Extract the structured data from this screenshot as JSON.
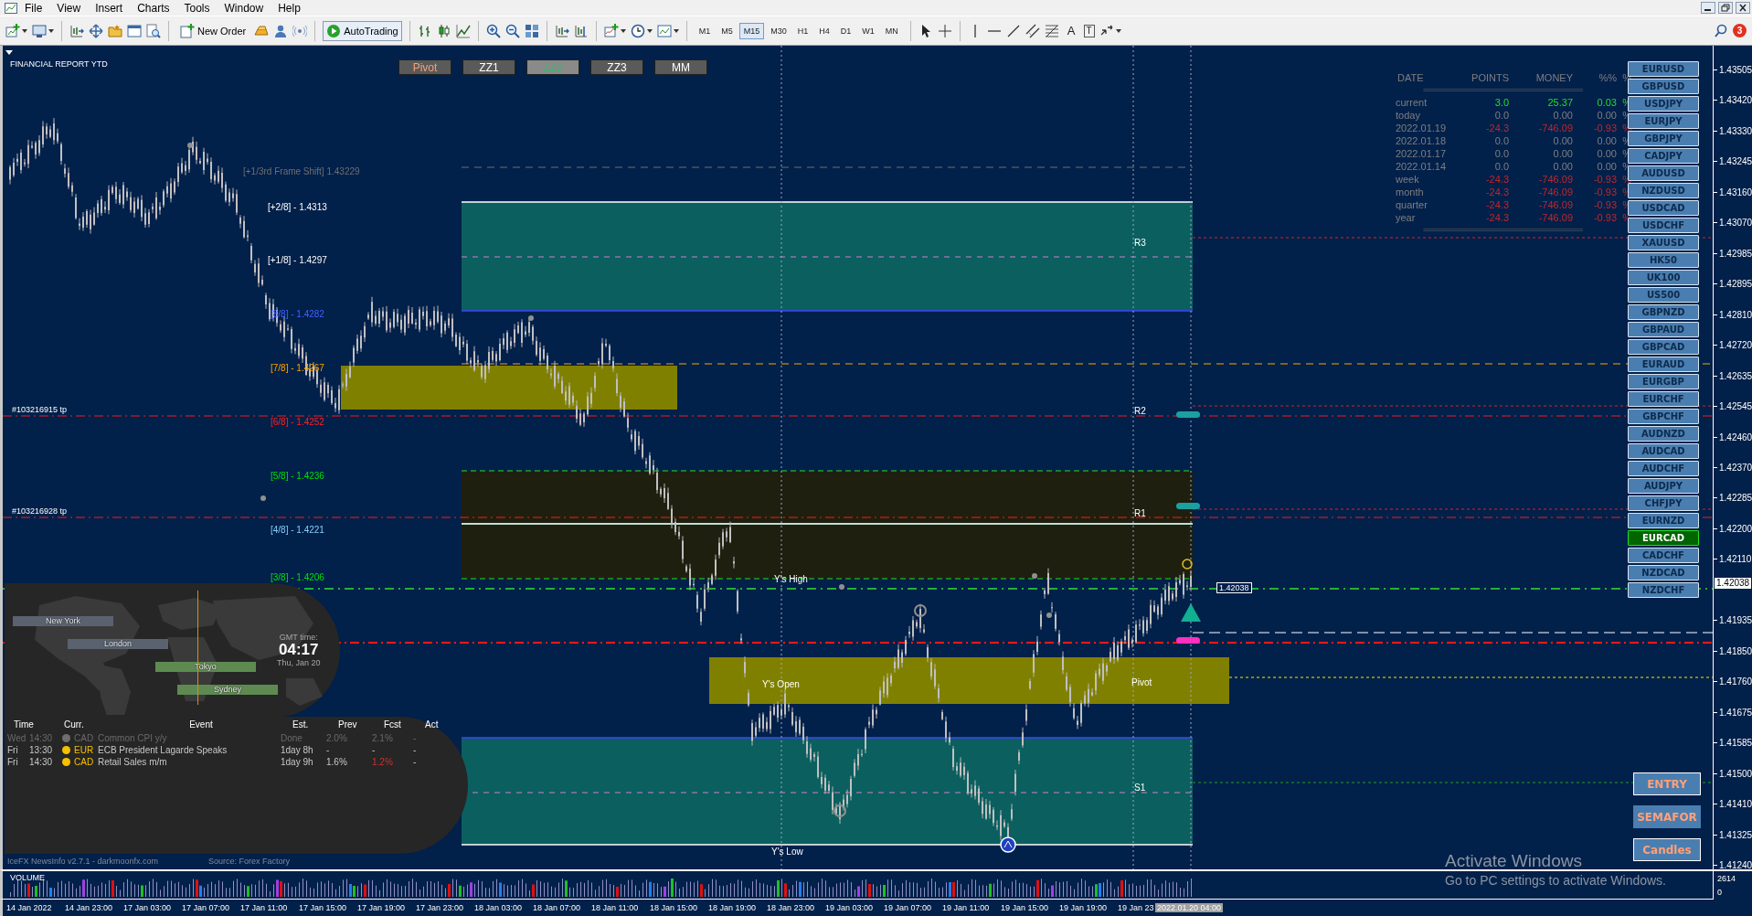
{
  "menu": [
    {
      "label": "File"
    },
    {
      "label": "View"
    },
    {
      "label": "Insert"
    },
    {
      "label": "Charts"
    },
    {
      "label": "Tools"
    },
    {
      "label": "Window"
    },
    {
      "label": "Help"
    }
  ],
  "toolbar": {
    "new_order": "New Order",
    "autotrading": "AutoTrading",
    "timeframes": [
      {
        "label": "M1",
        "selected": false
      },
      {
        "label": "M5",
        "selected": false
      },
      {
        "label": "M15",
        "selected": true
      },
      {
        "label": "M30",
        "selected": false
      },
      {
        "label": "H1",
        "selected": false
      },
      {
        "label": "H4",
        "selected": false
      },
      {
        "label": "D1",
        "selected": false
      },
      {
        "label": "W1",
        "selected": false
      },
      {
        "label": "MN",
        "selected": false
      }
    ],
    "text_tool": "A",
    "label_tool": "T",
    "notifications": "3"
  },
  "chart": {
    "title": "FINANCIAL REPORT YTD",
    "indicator_buttons": [
      {
        "label": "Pivot",
        "pressed": false,
        "highlighted": true
      },
      {
        "label": "ZZ1",
        "pressed": false,
        "highlighted": false
      },
      {
        "label": "ZZ2",
        "pressed": true,
        "highlighted": false
      },
      {
        "label": "ZZ3",
        "pressed": false,
        "highlighted": false
      },
      {
        "label": "MM",
        "pressed": false,
        "highlighted": false
      }
    ],
    "levels": [
      {
        "text": "[+1/3rd Frame Shift]  1.43229",
        "color": "#6f6f6f"
      },
      {
        "text": "[+2/8] - 1.4313",
        "color": "#ffffff"
      },
      {
        "text": "[+1/8] - 1.4297",
        "color": "#ffffff"
      },
      {
        "text": "[8/8] - 1.4282",
        "color": "#4060ff"
      },
      {
        "text": "[7/8] - 1.4267",
        "color": "#ffa500"
      },
      {
        "text": "[6/8] - 1.4252",
        "color": "#ff2020"
      },
      {
        "text": "[5/8] - 1.4236",
        "color": "#00e000"
      },
      {
        "text": "[4/8] - 1.4221",
        "color": "#87cefa"
      },
      {
        "text": "[3/8] - 1.4206",
        "color": "#00e000"
      }
    ],
    "trade_labels": [
      "#103216915 tp",
      "#103216928 tp"
    ],
    "zone_labels": [
      "R3",
      "R2",
      "R1",
      "Y's High",
      "Y's Open",
      "Pivot",
      "S1",
      "Y's Low"
    ],
    "price_tag": "1.42038"
  },
  "report": {
    "columns": [
      "DATE",
      "POINTS",
      "MONEY",
      "%%",
      "%"
    ],
    "separator_top": "=========================================",
    "separator_bottom": "=========================================",
    "rows": [
      {
        "label": "current",
        "points": "3.0",
        "money": "25.37",
        "percent": "0.03",
        "unit": "%",
        "kind": "gain"
      },
      {
        "label": "today",
        "points": "0.0",
        "money": "0.00",
        "percent": "0.00",
        "unit": "%",
        "kind": "flat"
      },
      {
        "label": "2022.01.19",
        "points": "-24.3",
        "money": "-746.09",
        "percent": "-0.93",
        "unit": "%",
        "kind": "loss"
      },
      {
        "label": "2022.01.18",
        "points": "0.0",
        "money": "0.00",
        "percent": "0.00",
        "unit": "%",
        "kind": "flat"
      },
      {
        "label": "2022.01.17",
        "points": "0.0",
        "money": "0.00",
        "percent": "0.00",
        "unit": "%",
        "kind": "flat"
      },
      {
        "label": "2022.01.14",
        "points": "0.0",
        "money": "0.00",
        "percent": "0.00",
        "unit": "%",
        "kind": "flat"
      },
      {
        "label": "week",
        "points": "-24.3",
        "money": "-746.09",
        "percent": "-0.93",
        "unit": "%",
        "kind": "loss"
      },
      {
        "label": "month",
        "points": "-24.3",
        "money": "-746.09",
        "percent": "-0.93",
        "unit": "%",
        "kind": "loss"
      },
      {
        "label": "quarter",
        "points": "-24.3",
        "money": "-746.09",
        "percent": "-0.93",
        "unit": "%",
        "kind": "loss"
      },
      {
        "label": "year",
        "points": "-24.3",
        "money": "-746.09",
        "percent": "-0.93",
        "unit": "%",
        "kind": "loss"
      }
    ]
  },
  "symbols": [
    {
      "label": "EURUSD",
      "selected": false
    },
    {
      "label": "GBPUSD",
      "selected": false
    },
    {
      "label": "USDJPY",
      "selected": false
    },
    {
      "label": "EURJPY",
      "selected": false
    },
    {
      "label": "GBPJPY",
      "selected": false
    },
    {
      "label": "CADJPY",
      "selected": false
    },
    {
      "label": "AUDUSD",
      "selected": false
    },
    {
      "label": "NZDUSD",
      "selected": false
    },
    {
      "label": "USDCAD",
      "selected": false
    },
    {
      "label": "USDCHF",
      "selected": false
    },
    {
      "label": "XAUUSD",
      "selected": false
    },
    {
      "label": "HK50",
      "selected": false
    },
    {
      "label": "UK100",
      "selected": false
    },
    {
      "label": "US500",
      "selected": false
    },
    {
      "label": "GBPNZD",
      "selected": false
    },
    {
      "label": "GBPAUD",
      "selected": false
    },
    {
      "label": "GBPCAD",
      "selected": false
    },
    {
      "label": "EURAUD",
      "selected": false
    },
    {
      "label": "EURGBP",
      "selected": false
    },
    {
      "label": "EURCHF",
      "selected": false
    },
    {
      "label": "GBPCHF",
      "selected": false
    },
    {
      "label": "AUDNZD",
      "selected": false
    },
    {
      "label": "AUDCAD",
      "selected": false
    },
    {
      "label": "AUDCHF",
      "selected": false
    },
    {
      "label": "AUDJPY",
      "selected": false
    },
    {
      "label": "CHFJPY",
      "selected": false
    },
    {
      "label": "EURNZD",
      "selected": false
    },
    {
      "label": "EURCAD",
      "selected": true
    },
    {
      "label": "CADCHF",
      "selected": false
    },
    {
      "label": "NZDCAD",
      "selected": false
    },
    {
      "label": "NZDCHF",
      "selected": false
    }
  ],
  "action_buttons": [
    "ENTRY",
    "SEMAFOR",
    "Candles"
  ],
  "price_axis": {
    "labels": [
      "1.43505",
      "1.43420",
      "1.43330",
      "1.43245",
      "1.43160",
      "1.43070",
      "1.42985",
      "1.42895",
      "1.42810",
      "1.42720",
      "1.42635",
      "1.42545",
      "1.42460",
      "1.42370",
      "1.42285",
      "1.42200",
      "1.42110",
      "1.41935",
      "1.41850",
      "1.41760",
      "1.41675",
      "1.41585",
      "1.41500",
      "1.41410",
      "1.41325",
      "1.41240"
    ],
    "current": "1.42038"
  },
  "volume": {
    "title": "VOLUME",
    "max": "2614",
    "min": "0"
  },
  "time_axis": {
    "labels": [
      "14 Jan 2022",
      "14 Jan 23:00",
      "17 Jan 03:00",
      "17 Jan 07:00",
      "17 Jan 11:00",
      "17 Jan 15:00",
      "17 Jan 19:00",
      "17 Jan 23:00",
      "18 Jan 03:00",
      "18 Jan 07:00",
      "18 Jan 11:00",
      "18 Jan 15:00",
      "18 Jan 19:00",
      "18 Jan 23:00",
      "19 Jan 03:00",
      "19 Jan 07:00",
      "19 Jan 11:00",
      "19 Jan 15:00",
      "19 Jan 19:00",
      "19 Jan 23"
    ],
    "current": "2022.01.20 04:00"
  },
  "news": {
    "sessions": [
      {
        "name": "New York",
        "active": false
      },
      {
        "name": "London",
        "active": false
      },
      {
        "name": "Tokyo",
        "active": true
      },
      {
        "name": "Sydney",
        "active": true
      }
    ],
    "gmt_label": "GMT time:",
    "gmt_time": "04:17",
    "gmt_date": "Thu, Jan 20",
    "columns": [
      "Time",
      "Curr.",
      "Event",
      "Est.",
      "Prev",
      "Fcst",
      "Act"
    ],
    "events": [
      {
        "day": "Wed",
        "time": "14:30",
        "currency": "CAD",
        "event": "Common CPI y/y",
        "est": "Done",
        "prev": "2.0%",
        "fcst": "2.1%",
        "act": "-",
        "past": true,
        "fcst_worse": false,
        "color": "#6e6e6e"
      },
      {
        "day": "Fri",
        "time": "13:30",
        "currency": "EUR",
        "event": "ECB President Lagarde Speaks",
        "est": "1day 8h",
        "prev": "-",
        "fcst": "-",
        "act": "-",
        "past": false,
        "fcst_worse": false,
        "color": "#f5c000"
      },
      {
        "day": "Fri",
        "time": "14:30",
        "currency": "CAD",
        "event": "Retail Sales m/m",
        "est": "1day 9h",
        "prev": "1.6%",
        "fcst": "1.2%",
        "act": "-",
        "past": false,
        "fcst_worse": true,
        "color": "#f5c000"
      }
    ],
    "footer": "IceFX NewsInfo v2.7.1  -  darkmoonfx.com",
    "source": "Source: Forex Factory"
  },
  "os_notice": {
    "title": "Activate Windows",
    "text": "Go to PC settings to activate Windows."
  }
}
